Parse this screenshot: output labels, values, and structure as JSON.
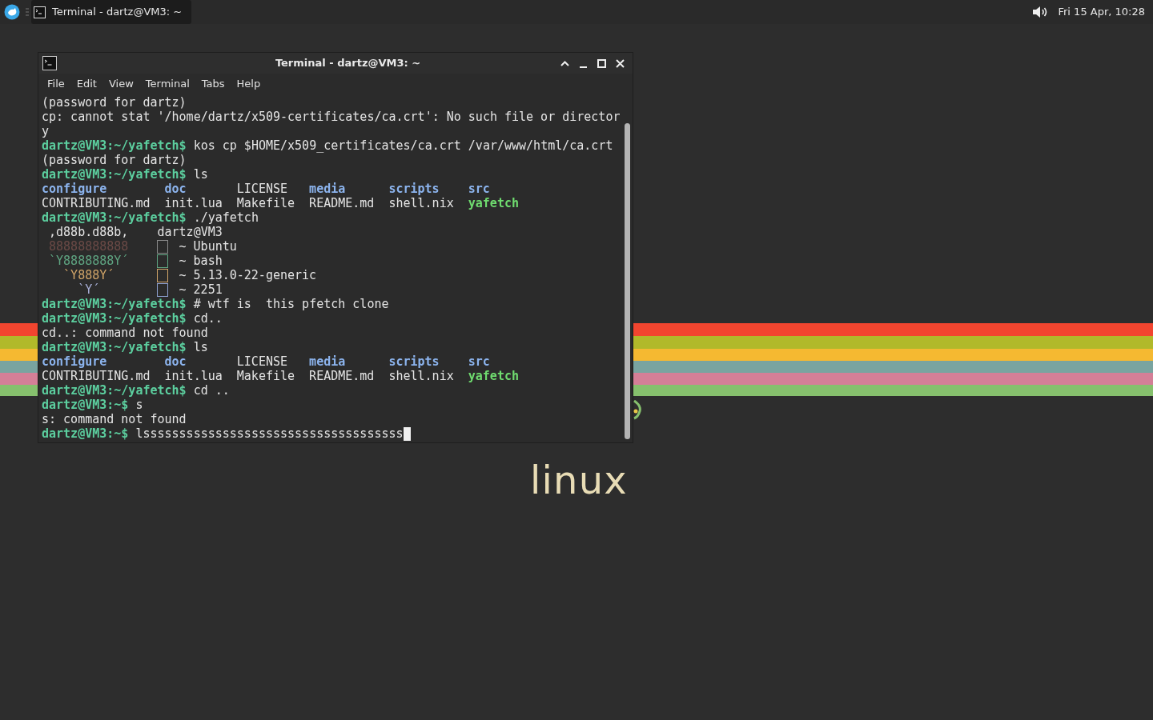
{
  "panel": {
    "task": {
      "title": "Terminal - dartz@VM3: ~",
      "selected": true
    },
    "clock": "Fri 15 Apr, 10:28"
  },
  "desktop": {
    "logo_text": "linux"
  },
  "window": {
    "title": "Terminal - dartz@VM3: ~",
    "menu": [
      "File",
      "Edit",
      "View",
      "Terminal",
      "Tabs",
      "Help"
    ],
    "lines": [
      [
        {
          "kind": "plain",
          "text": "(password for dartz)"
        }
      ],
      [
        {
          "kind": "plain",
          "text": "cp: cannot stat '/home/dartz/x509-certificates/ca.crt': No such file or director"
        }
      ],
      [
        {
          "kind": "plain",
          "text": "y"
        }
      ],
      [
        {
          "kind": "prompt",
          "text": "dartz@VM3:~/yafetch$"
        },
        {
          "kind": "plain",
          "text": " kos cp $HOME/x509_certificates/ca.crt /var/www/html/ca.crt"
        }
      ],
      [
        {
          "kind": "plain",
          "text": "(password for dartz)"
        }
      ],
      [
        {
          "kind": "prompt",
          "text": "dartz@VM3:~/yafetch$"
        },
        {
          "kind": "plain",
          "text": " ls"
        }
      ],
      [
        {
          "kind": "ls",
          "cells": [
            {
              "kind": "dir",
              "text": "configure"
            },
            {
              "kind": "dir",
              "text": "doc"
            },
            {
              "kind": "plain",
              "text": "LICENSE"
            },
            {
              "kind": "dir",
              "text": "media"
            },
            {
              "kind": "dir",
              "text": "scripts"
            },
            {
              "kind": "dir",
              "text": "src"
            }
          ]
        }
      ],
      [
        {
          "kind": "ls",
          "cells": [
            {
              "kind": "plain",
              "text": "CONTRIBUTING.md"
            },
            {
              "kind": "plain",
              "text": "init.lua"
            },
            {
              "kind": "plain",
              "text": "Makefile"
            },
            {
              "kind": "plain",
              "text": "README.md"
            },
            {
              "kind": "plain",
              "text": "shell.nix"
            },
            {
              "kind": "exec",
              "text": "yafetch"
            }
          ]
        }
      ],
      [
        {
          "kind": "prompt",
          "text": "dartz@VM3:~/yafetch$"
        },
        {
          "kind": "plain",
          "text": " ./yafetch"
        }
      ],
      [
        {
          "kind": "plain",
          "text": " ,d88b.d88b,    dartz@VM3"
        }
      ],
      [
        {
          "kind": "art",
          "text": " 88888888888",
          "color": "#6b4a46"
        },
        {
          "kind": "box",
          "color": "#8a8a8a"
        },
        {
          "kind": "plain",
          "text": " ~ Ubuntu"
        }
      ],
      [
        {
          "kind": "art",
          "text": " `Y8888888Y´",
          "color": "#5fa582"
        },
        {
          "kind": "box",
          "color": "#5fa582"
        },
        {
          "kind": "plain",
          "text": " ~ bash"
        }
      ],
      [
        {
          "kind": "art",
          "text": "   `Y888Y´",
          "color": "#d0a468"
        },
        {
          "kind": "box",
          "color": "#d0a468"
        },
        {
          "kind": "plain",
          "text": " ~ 5.13.0-22-generic"
        }
      ],
      [
        {
          "kind": "art",
          "text": "     `Y´",
          "color": "#a9b0d8"
        },
        {
          "kind": "box",
          "color": "#8ea0d0"
        },
        {
          "kind": "plain",
          "text": " ~ 2251"
        }
      ],
      [
        {
          "kind": "prompt",
          "text": "dartz@VM3:~/yafetch$"
        },
        {
          "kind": "plain",
          "text": " # wtf is  this pfetch clone"
        }
      ],
      [
        {
          "kind": "prompt",
          "text": "dartz@VM3:~/yafetch$"
        },
        {
          "kind": "plain",
          "text": " cd.."
        }
      ],
      [
        {
          "kind": "plain",
          "text": "cd..: command not found"
        }
      ],
      [
        {
          "kind": "prompt",
          "text": "dartz@VM3:~/yafetch$"
        },
        {
          "kind": "plain",
          "text": " ls"
        }
      ],
      [
        {
          "kind": "ls",
          "cells": [
            {
              "kind": "dir",
              "text": "configure"
            },
            {
              "kind": "dir",
              "text": "doc"
            },
            {
              "kind": "plain",
              "text": "LICENSE"
            },
            {
              "kind": "dir",
              "text": "media"
            },
            {
              "kind": "dir",
              "text": "scripts"
            },
            {
              "kind": "dir",
              "text": "src"
            }
          ]
        }
      ],
      [
        {
          "kind": "ls",
          "cells": [
            {
              "kind": "plain",
              "text": "CONTRIBUTING.md"
            },
            {
              "kind": "plain",
              "text": "init.lua"
            },
            {
              "kind": "plain",
              "text": "Makefile"
            },
            {
              "kind": "plain",
              "text": "README.md"
            },
            {
              "kind": "plain",
              "text": "shell.nix"
            },
            {
              "kind": "exec",
              "text": "yafetch"
            }
          ]
        }
      ],
      [
        {
          "kind": "prompt",
          "text": "dartz@VM3:~/yafetch$"
        },
        {
          "kind": "plain",
          "text": " cd .."
        }
      ],
      [
        {
          "kind": "prompt",
          "text": "dartz@VM3:~$"
        },
        {
          "kind": "plain",
          "text": " s"
        }
      ],
      [
        {
          "kind": "plain",
          "text": "s: command not found"
        }
      ],
      [
        {
          "kind": "prompt",
          "text": "dartz@VM3:~$"
        },
        {
          "kind": "plain",
          "text": " lssssssssssssssssssssssssssssssssssss"
        },
        {
          "kind": "cursor"
        }
      ]
    ]
  }
}
